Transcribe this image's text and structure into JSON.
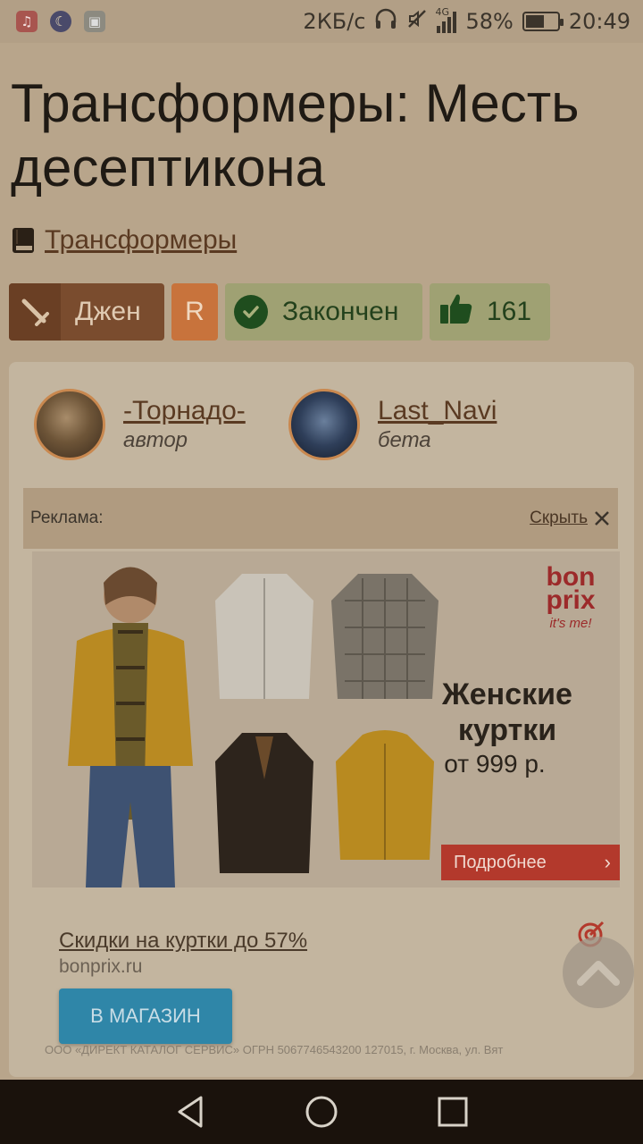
{
  "status_bar": {
    "apps": [
      "music-app-icon",
      "moon-app-icon",
      "gallery-app-icon"
    ],
    "net_speed": "2КБ/с",
    "signal_type": "4G",
    "battery_pct": "58%",
    "battery_level": 0.58,
    "time": "20:49"
  },
  "story": {
    "title": "Трансформеры: Месть десептикона",
    "fandom": "Трансформеры",
    "badges": {
      "direction": "Джен",
      "rating": "R",
      "status": "Закончен",
      "likes": "161"
    }
  },
  "people": [
    {
      "name": "-Торнадо-",
      "role": "автор"
    },
    {
      "name": "Last_Navi",
      "role": "бета"
    }
  ],
  "ad": {
    "label": "Реклама:",
    "hide": "Скрыть",
    "brand": "bon prix",
    "brand_tagline": "it's me!",
    "headline": "Женские куртки",
    "price": "от 999 р.",
    "more": "Подробнее",
    "link_text": "Скидки на куртки до 57%",
    "domain": "bonprix.ru",
    "shop_button": "В МАГАЗИН",
    "legal": "ООО «ДИРЕКТ КАТАЛОГ СЕРВИС» ОГРН 5067746543200 127015, г. Москва, ул. Вят"
  },
  "colors": {
    "accent_link": "#5a3a22",
    "status_done": "#9fa173",
    "shop_button": "#2f86a8",
    "promo_button": "#b3392c"
  }
}
